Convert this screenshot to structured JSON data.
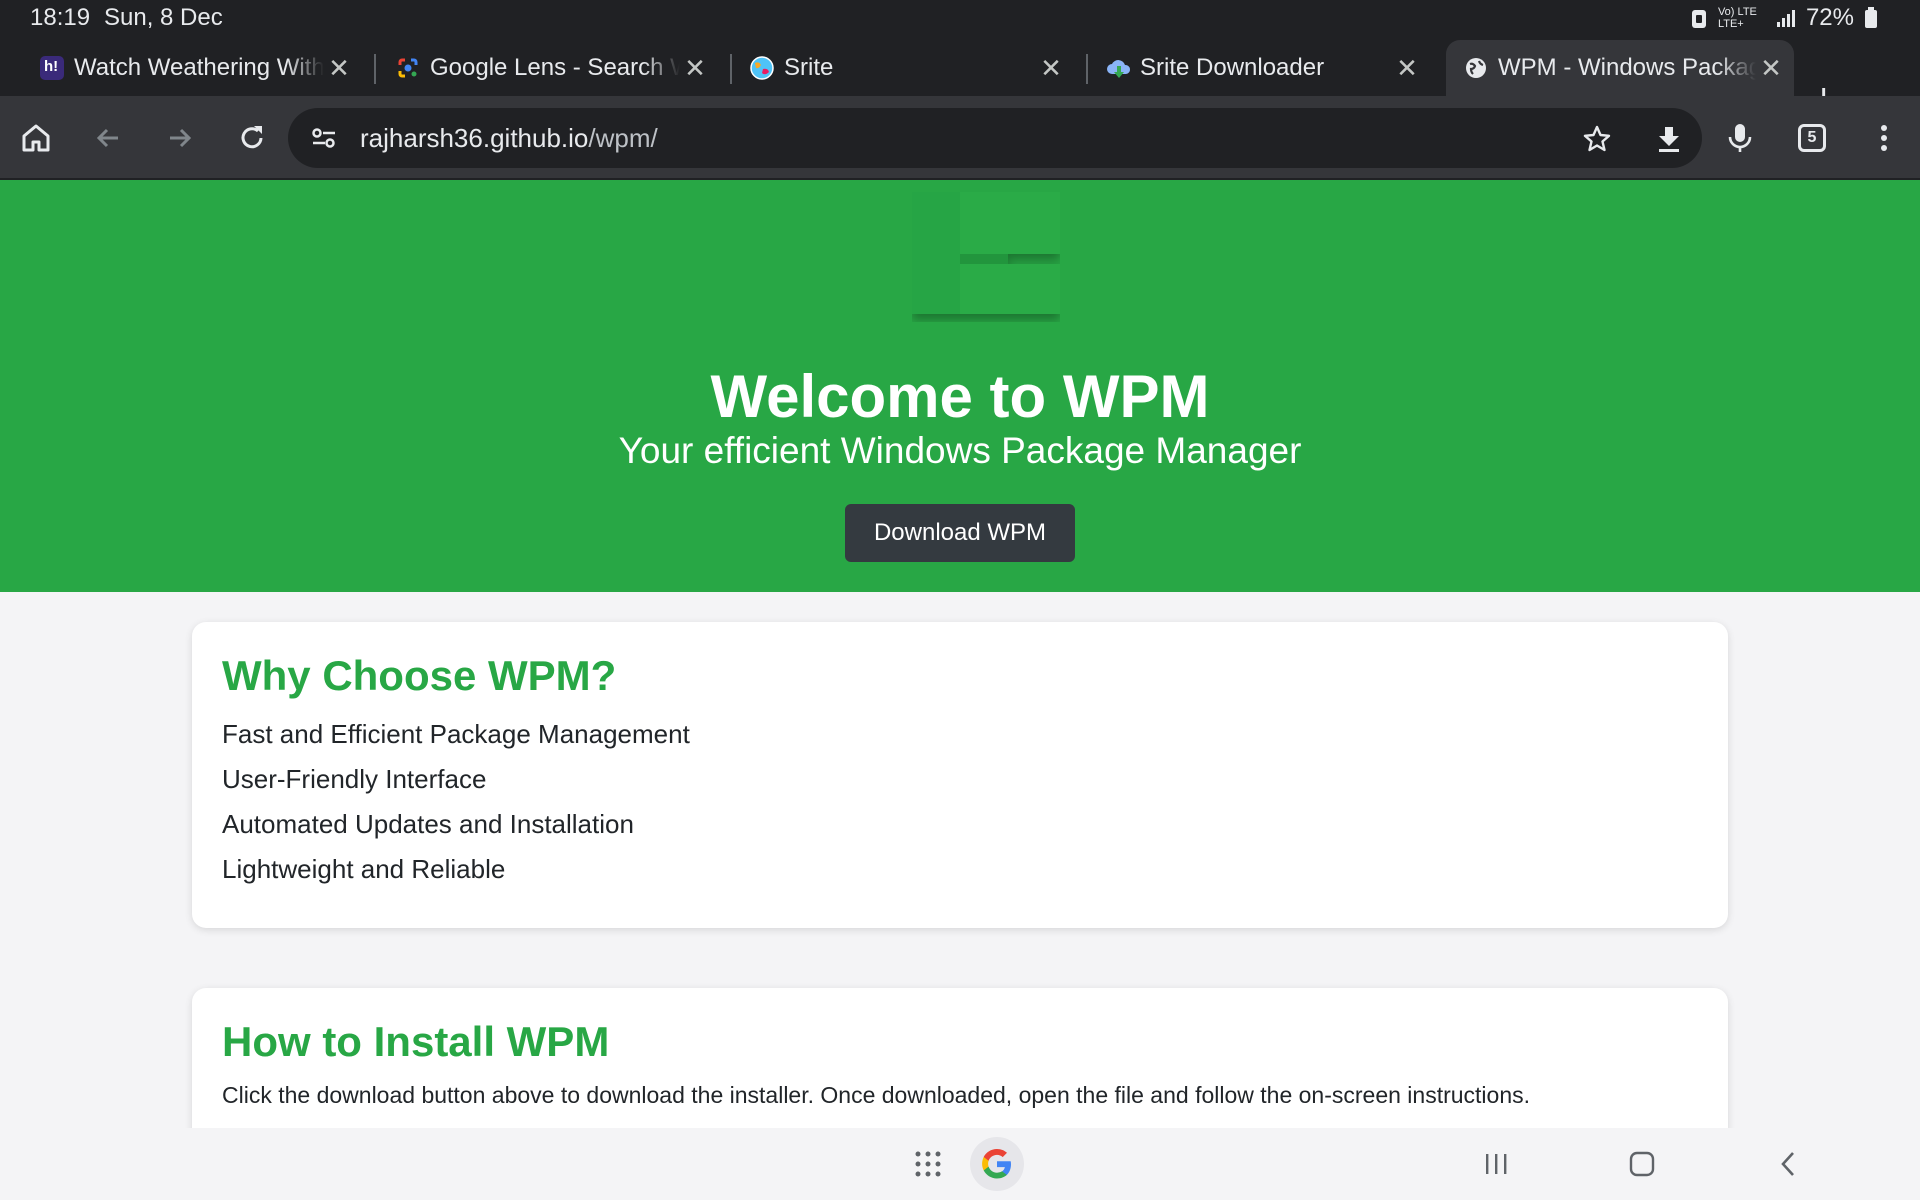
{
  "status_bar": {
    "time": "18:19",
    "date": "Sun, 8 Dec",
    "network": "Vo) LTE LTE+",
    "battery": "72%"
  },
  "tabs": [
    {
      "title": "Watch Weathering With You",
      "favicon": "hianime-icon",
      "favicon_color": "#5b3fd1"
    },
    {
      "title": "Google Lens - Search W",
      "favicon": "google-lens-icon",
      "favicon_color": "#4285f4"
    },
    {
      "title": "Srite",
      "favicon": "globe-color-icon",
      "favicon_color": "#f2a900"
    },
    {
      "title": "Srite Downloader",
      "favicon": "cloud-download-icon",
      "favicon_color": "#8ab4f8"
    },
    {
      "title": "WPM - Windows Package",
      "favicon": "globe-icon",
      "favicon_color": "#e8eaed",
      "active": true
    }
  ],
  "toolbar": {
    "url_host": "rajharsh36.github.io",
    "url_path": "/wpm/",
    "tab_count": "5"
  },
  "page": {
    "hero_bg": "#28a745",
    "title": "Welcome to WPM",
    "subtitle": "Your efficient Windows Package Manager",
    "download_label": "Download WPM",
    "why": {
      "heading": "Why Choose WPM?",
      "items": [
        "Fast and Efficient Package Management",
        "User-Friendly Interface",
        "Automated Updates and Installation",
        "Lightweight and Reliable"
      ]
    },
    "install": {
      "heading": "How to Install WPM",
      "text": "Click the download button above to download the installer. Once downloaded, open the file and follow the on-screen instructions."
    }
  }
}
